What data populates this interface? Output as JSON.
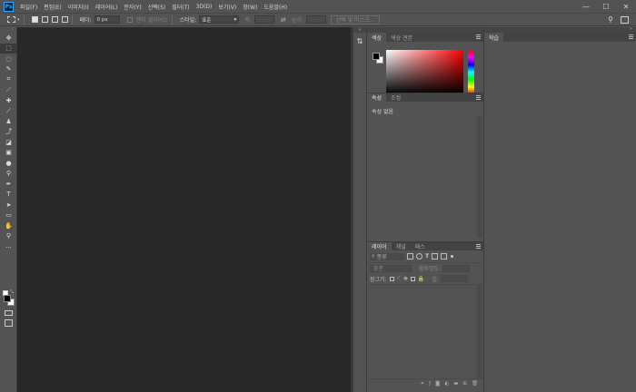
{
  "app": {
    "logo_text": "Ps",
    "menu": [
      "파일(F)",
      "편집(E)",
      "이미지(I)",
      "레이어(L)",
      "문자(Y)",
      "선택(S)",
      "필터(T)",
      "3D(D)",
      "보기(V)",
      "창(W)",
      "도움말(H)"
    ],
    "window_controls": [
      "—",
      "☐",
      "✕"
    ]
  },
  "options_bar": {
    "feather_label": "페더:",
    "feather_value": "0 px",
    "antialias_label": "앤티 앨리어스",
    "style_label": "스타일:",
    "style_value": "표준",
    "width_label": "폭:",
    "height_label": "높이:",
    "select_mask_button": "선택 및 마스크..."
  },
  "tools": [
    {
      "name": "move-tool",
      "glyph": "✥"
    },
    {
      "name": "marquee-tool",
      "glyph": "⬚"
    },
    {
      "name": "lasso-tool",
      "glyph": "◌"
    },
    {
      "name": "magic-wand-tool",
      "glyph": "✎"
    },
    {
      "name": "crop-tool",
      "glyph": "⌗"
    },
    {
      "name": "eyedropper-tool",
      "glyph": "⟋"
    },
    {
      "name": "healing-brush-tool",
      "glyph": "✚"
    },
    {
      "name": "brush-tool",
      "glyph": "⟋"
    },
    {
      "name": "clone-stamp-tool",
      "glyph": "♟"
    },
    {
      "name": "history-brush-tool",
      "glyph": "⤴"
    },
    {
      "name": "eraser-tool",
      "glyph": "◪"
    },
    {
      "name": "gradient-tool",
      "glyph": "▣"
    },
    {
      "name": "blur-tool",
      "glyph": "●"
    },
    {
      "name": "dodge-tool",
      "glyph": "⚲"
    },
    {
      "name": "pen-tool",
      "glyph": "✒"
    },
    {
      "name": "type-tool",
      "glyph": "T"
    },
    {
      "name": "path-selection-tool",
      "glyph": "➤"
    },
    {
      "name": "rectangle-tool",
      "glyph": "▭"
    },
    {
      "name": "hand-tool",
      "glyph": "✋"
    },
    {
      "name": "zoom-tool",
      "glyph": "⚲"
    },
    {
      "name": "more-tools",
      "glyph": "···"
    }
  ],
  "colors": {
    "foreground": "#000000",
    "background": "#ffffff",
    "picker_hue": "#ff0000",
    "accent": "#31a8ff"
  },
  "color_panel": {
    "tabs": [
      "색상",
      "색상 견본"
    ]
  },
  "properties_panel": {
    "tabs": [
      "속성",
      "조정"
    ],
    "empty_text": "속성 없음"
  },
  "layers_panel": {
    "tabs": [
      "레이어",
      "채널",
      "패스"
    ],
    "filter_label": "종류",
    "blend_mode": "표준",
    "opacity_label": "불투명도:",
    "lock_label": "잠그기:",
    "fill_label": "칠:"
  },
  "learn_panel": {
    "tab": "학습"
  }
}
